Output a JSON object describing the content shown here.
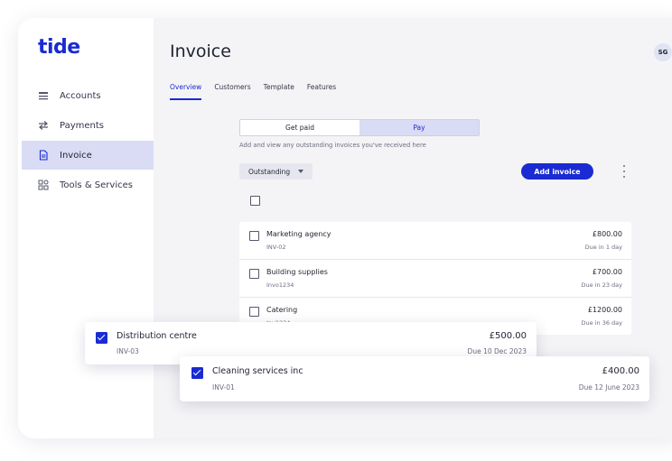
{
  "app": {
    "logo": "tide",
    "avatar_initials": "SG",
    "accent_color": "#1a2bd3"
  },
  "sidebar": {
    "items": [
      {
        "label": "Accounts",
        "icon": "accounts-icon",
        "active": false
      },
      {
        "label": "Payments",
        "icon": "payments-icon",
        "active": false
      },
      {
        "label": "Invoice",
        "icon": "invoice-icon",
        "active": true
      },
      {
        "label": "Tools & Services",
        "icon": "tools-icon",
        "active": false
      }
    ]
  },
  "main": {
    "title": "Invoice",
    "tabs": [
      {
        "label": "Overview",
        "active": true
      },
      {
        "label": "Customers",
        "active": false
      },
      {
        "label": "Template",
        "active": false
      },
      {
        "label": "Features",
        "active": false
      }
    ],
    "toggle": {
      "left": "Get paid",
      "right": "Pay",
      "selected": "Pay"
    },
    "helper_text": "Add and view any outstanding invoices you've received here",
    "filter": {
      "selected": "Outstanding"
    },
    "add_button": "Add invoice",
    "invoices": [
      {
        "name": "Marketing agency",
        "ref": "INV-02",
        "amount": "£800.00",
        "due": "Due in 1 day"
      },
      {
        "name": "Building supplies",
        "ref": "Invo1234",
        "amount": "£700.00",
        "due": "Due in 23 day"
      },
      {
        "name": "Catering",
        "ref": "Inv1234",
        "amount": "£1200.00",
        "due": "Due in 36 day"
      }
    ]
  },
  "selected_cards": [
    {
      "name": "Distribution centre",
      "ref": "INV-03",
      "amount": "£500.00",
      "due": "Due 10 Dec 2023",
      "checked": true
    },
    {
      "name": "Cleaning services inc",
      "ref": "INV-01",
      "amount": "£400.00",
      "due": "Due 12 June 2023",
      "checked": true
    }
  ]
}
